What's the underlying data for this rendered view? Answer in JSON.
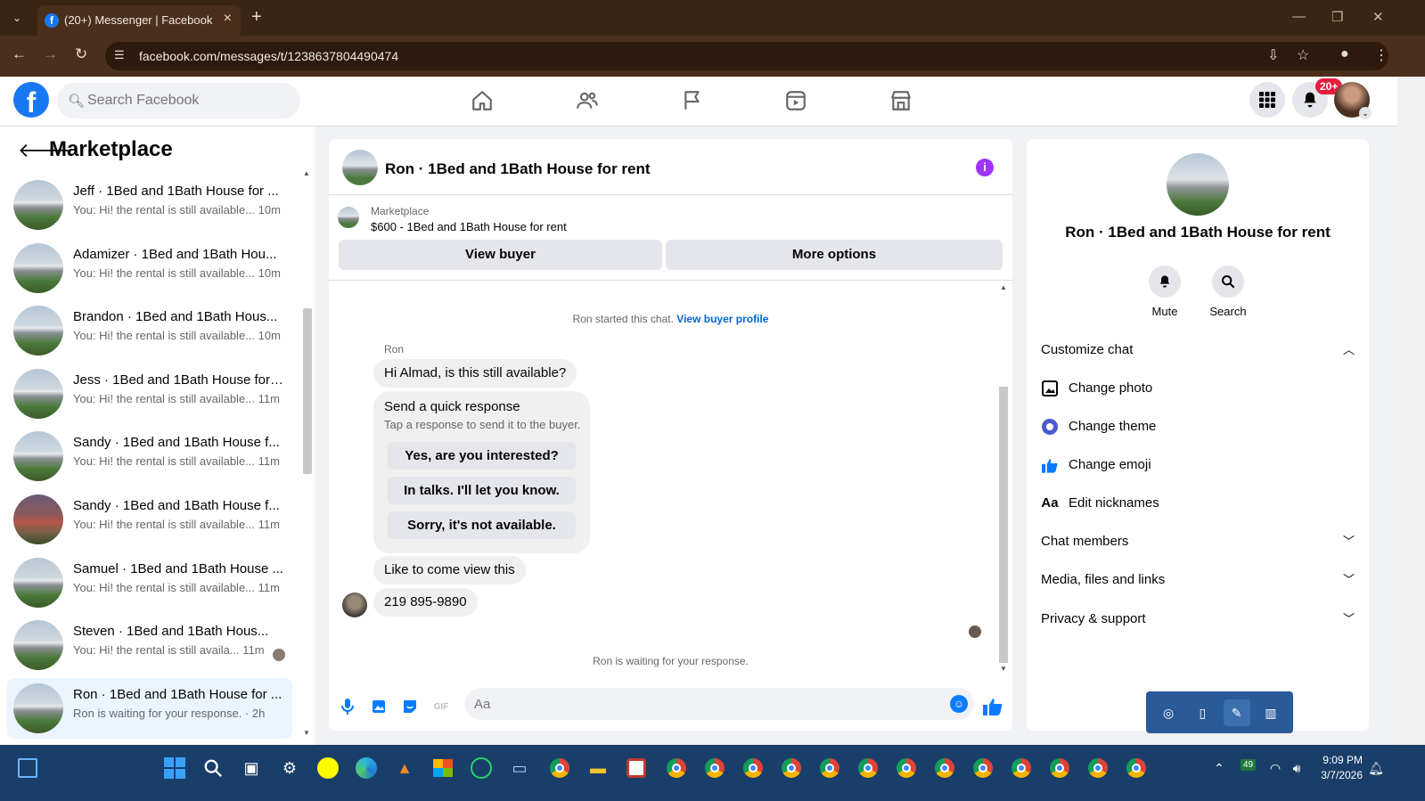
{
  "browser": {
    "tab_title": "(20+) Messenger | Facebook",
    "url": "facebook.com/messages/t/1238637804490474"
  },
  "fb": {
    "search_placeholder": "Search Facebook",
    "notif_badge": "20+",
    "nav_icons": [
      "home-icon",
      "friends-icon",
      "pages-flag-icon",
      "video-icon",
      "marketplace-icon"
    ]
  },
  "left": {
    "title": "Marketplace",
    "conversations": [
      {
        "name": "Jeff · 1Bed and 1Bath House for ...",
        "preview": "You: Hi! the rental is still available... 10m"
      },
      {
        "name": "Adamizer · 1Bed and 1Bath Hou...",
        "preview": "You: Hi! the rental is still available... 10m"
      },
      {
        "name": "Brandon · 1Bed and 1Bath Hous...",
        "preview": "You: Hi! the rental is still available... 10m"
      },
      {
        "name": "Jess · 1Bed and 1Bath House for ...",
        "preview": "You: Hi! the rental is still available... 11m"
      },
      {
        "name": "Sandy · 1Bed and 1Bath House f...",
        "preview": "You: Hi! the rental is still available... 11m"
      },
      {
        "name": "Sandy · 1Bed and 1Bath House f...",
        "preview": "You: Hi! the rental is still available... 11m"
      },
      {
        "name": "Samuel · 1Bed and 1Bath House ...",
        "preview": "You: Hi! the rental is still available... 11m"
      },
      {
        "name": "Steven · 1Bed and 1Bath Hous...",
        "preview": "You: Hi! the rental is still availa... 11m"
      },
      {
        "name": "Ron · 1Bed and 1Bath House for ...",
        "preview": "Ron is waiting for your response. · 2h"
      }
    ]
  },
  "chat": {
    "title": "Ron · 1Bed and 1Bath House for rent",
    "marketplace_label": "Marketplace",
    "listing": "$600 - 1Bed and 1Bath House for rent",
    "view_buyer": "View buyer",
    "more_options": "More options",
    "started_text": "Ron started this chat.",
    "view_buyer_profile": "View buyer profile",
    "sender": "Ron",
    "msg1": "Hi Almad, is this still available?",
    "quick_title": "Send a quick response",
    "quick_sub": "Tap a response to send it to the buyer.",
    "quick_options": [
      "Yes, are you interested?",
      "In talks. I'll let you know.",
      "Sorry, it's not available."
    ],
    "msg2": "Like to come view this",
    "msg3": "219 895-9890",
    "waiting": "Ron is waiting for your response.",
    "input_placeholder": "Aa"
  },
  "right": {
    "name": "Ron · 1Bed and 1Bath House for rent",
    "mute": "Mute",
    "search": "Search",
    "customize": "Customize chat",
    "change_photo": "Change photo",
    "change_theme": "Change theme",
    "change_emoji": "Change emoji",
    "edit_nicknames": "Edit nicknames",
    "chat_members": "Chat members",
    "media": "Media, files and links",
    "privacy": "Privacy & support"
  },
  "taskbar": {
    "time": "9:09 PM",
    "date": "3/7/2026",
    "battery": "49"
  },
  "colors": {
    "fb_blue": "#1877f2",
    "messenger_blue": "#0a7cff",
    "theme_purple": "#a033ff"
  }
}
